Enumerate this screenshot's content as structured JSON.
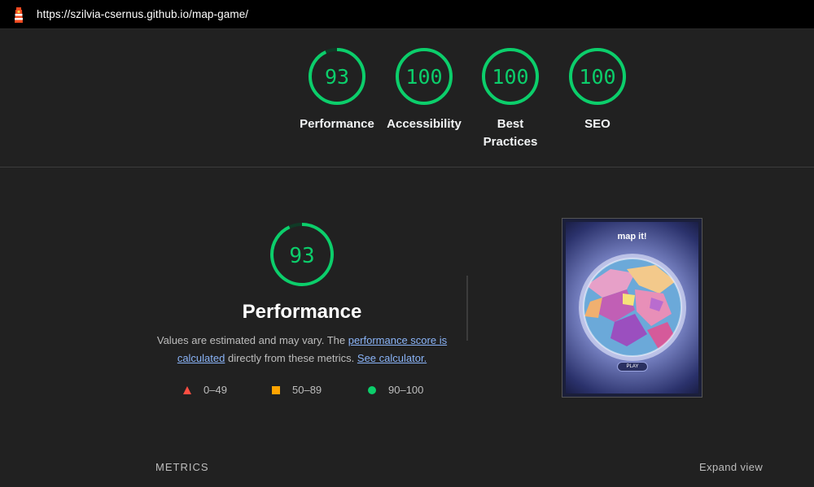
{
  "browser": {
    "url": "https://szilvia-csernus.github.io/map-game/"
  },
  "scores": [
    {
      "label": "Performance",
      "value": "93"
    },
    {
      "label": "Accessibility",
      "value": "100"
    },
    {
      "label": "Best Practices",
      "value": "100"
    },
    {
      "label": "SEO",
      "value": "100"
    }
  ],
  "performance": {
    "score": "93",
    "title": "Performance",
    "desc_prefix": "Values are estimated and may vary. The ",
    "desc_link1": "performance score is calculated",
    "desc_middle": " directly from these metrics. ",
    "desc_link2": "See calculator."
  },
  "legend": [
    {
      "range": "0–49",
      "icon": "triangle-icon",
      "color": "#ff4e42"
    },
    {
      "range": "50–89",
      "icon": "square-icon",
      "color": "#ffa400"
    },
    {
      "range": "90–100",
      "icon": "circle-icon",
      "color": "#0cce6b"
    }
  ],
  "screenshot": {
    "title": "map it!",
    "play_label": "PLAY"
  },
  "metrics": {
    "label": "METRICS",
    "expand_label": "Expand view"
  },
  "colors": {
    "pass": "#0cce6b",
    "background": "#212121",
    "link": "#8ab4f8"
  }
}
